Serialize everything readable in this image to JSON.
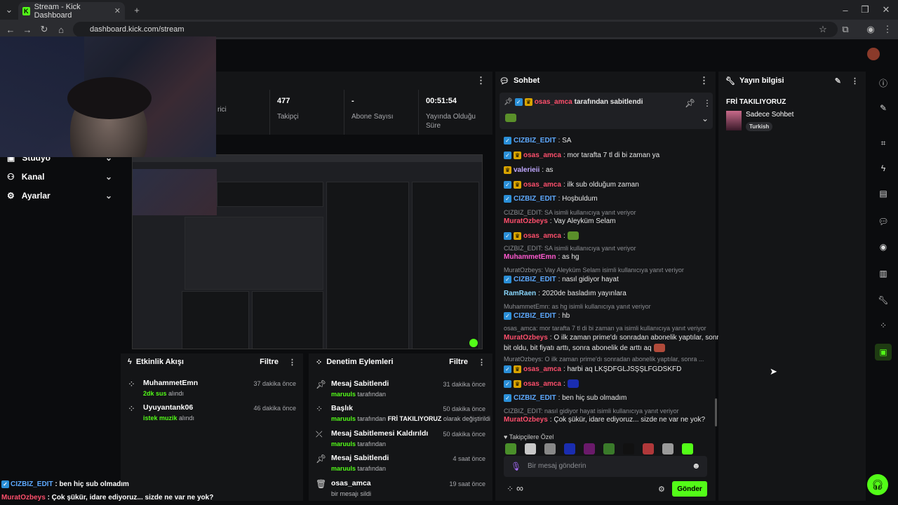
{
  "browser": {
    "tab_title": "Stream - Kick Dashboard",
    "url": "dashboard.kick.com/stream",
    "new_tab": "+",
    "close_tab": "✕"
  },
  "stats": [
    {
      "value": "",
      "label": "rici"
    },
    {
      "value": "477",
      "label": "Takipçi"
    },
    {
      "value": "-",
      "label": "Abone Sayısı"
    },
    {
      "value": "00:51:54",
      "label": "Yayında Olduğu Süre"
    }
  ],
  "nav": [
    {
      "label": "Stüdyo"
    },
    {
      "label": "Kanal"
    },
    {
      "label": "Ayarlar"
    }
  ],
  "chat": {
    "title": "Sohbet",
    "pinned": {
      "user": "osas_amca",
      "text": "tarafından sabitlendi"
    },
    "lines": [
      {
        "type": "msg",
        "user": "CIZBIZ_EDIT",
        "color": "blue",
        "badges": [
          "blue"
        ],
        "text": ": SA"
      },
      {
        "type": "msg",
        "user": "osas_amca",
        "color": "pink",
        "badges": [
          "blue",
          "gold"
        ],
        "text": ": mor tarafta 7 tl di bi zaman ya"
      },
      {
        "type": "msg",
        "user": "valerieii",
        "color": "lav",
        "badges": [
          "gold"
        ],
        "text": ": as"
      },
      {
        "type": "msg",
        "user": "osas_amca",
        "color": "pink",
        "badges": [
          "blue",
          "gold"
        ],
        "text": ": ilk sub olduğum zaman"
      },
      {
        "type": "msg",
        "user": "CIZBIZ_EDIT",
        "color": "blue",
        "badges": [
          "blue"
        ],
        "text": ": Hoşbuldum"
      },
      {
        "type": "reply",
        "text": "CIZBIZ_EDIT: SA isimli kullanıcıya yanıt veriyor"
      },
      {
        "type": "msg",
        "user": "MuratOzbeys",
        "color": "pink",
        "badges": [],
        "text": ": Vay Aleyküm Selam"
      },
      {
        "type": "msg",
        "user": "osas_amca",
        "color": "pink",
        "badges": [
          "blue",
          "gold"
        ],
        "text": ":",
        "emote": "#5a8f2a"
      },
      {
        "type": "reply",
        "text": "CIZBIZ_EDIT: SA isimli kullanıcıya yanıt veriyor"
      },
      {
        "type": "msg",
        "user": "MuhammetEmn",
        "color": "mag",
        "badges": [],
        "text": ": as hg"
      },
      {
        "type": "reply",
        "text": "MuratOzbeys: Vay Aleyküm Selam isimli kullanıcıya yanıt veriyor"
      },
      {
        "type": "msg",
        "user": "CIZBIZ_EDIT",
        "color": "blue",
        "badges": [
          "blue"
        ],
        "text": ": nasıl gidiyor hayat"
      },
      {
        "type": "msg",
        "user": "RamRaen",
        "color": "cyan",
        "badges": [],
        "text": ": 2020de basladım yayınlara"
      },
      {
        "type": "reply",
        "text": "MuhammetEmn: as hg isimli kullanıcıya yanıt veriyor"
      },
      {
        "type": "msg",
        "user": "CIZBIZ_EDIT",
        "color": "blue",
        "badges": [
          "blue"
        ],
        "text": ": hb"
      },
      {
        "type": "reply",
        "text": "osas_amca: mor tarafta 7 tl di bi zaman ya isimli kullanıcıya yanıt veriyor"
      },
      {
        "type": "msg",
        "user": "MuratOzbeys",
        "color": "pink",
        "badges": [],
        "text": ": O ilk zaman prime'dı sonradan abonelik yaptılar, sonra"
      },
      {
        "type": "cont",
        "text": "bit oldu, bit fiyatı arttı, sonra abonelik de arttı aq"
      },
      {
        "type": "reply",
        "text": "MuratOzbeys: O ilk zaman prime'dı sonradan abonelik yaptılar, sonra ..."
      },
      {
        "type": "msg",
        "user": "osas_amca",
        "color": "pink",
        "badges": [
          "blue",
          "gold"
        ],
        "text": ": harbi aq LKŞDFGLJSŞŞLFGDSKFD"
      },
      {
        "type": "msg",
        "user": "osas_amca",
        "color": "pink",
        "badges": [
          "blue",
          "gold"
        ],
        "text": ":",
        "emote": "#1a2db0"
      },
      {
        "type": "msg",
        "user": "CIZBIZ_EDIT",
        "color": "blue",
        "badges": [
          "blue"
        ],
        "text": ": ben hiç sub olmadım"
      },
      {
        "type": "reply",
        "text": "CIZBIZ_EDIT: nasıl gidiyor hayat isimli kullanıcıya yanıt veriyor"
      },
      {
        "type": "msg",
        "user": "MuratOzbeys",
        "color": "pink",
        "badges": [],
        "text": ": Çok şükür, idare ediyoruz... sizde ne var ne yok?"
      }
    ],
    "emote_section": "Takipçilere Özel",
    "emote_colors": [
      "#4a8f2a",
      "#c8c8c8",
      "#888888",
      "#1a2db0",
      "#6a1a6a",
      "#3a7a2a",
      "#111111",
      "#b0383a",
      "#9a9a9a",
      "#53fc18"
    ],
    "input_placeholder": "Bir mesaj gönderin",
    "send_label": "Gönder",
    "infinity": "∞"
  },
  "stream_info": {
    "title_label": "Yayın bilgisi",
    "stream_title": "FRİ TAKILIYORUZ",
    "category": "Sadece Sohbet",
    "tag": "Turkish"
  },
  "events": {
    "title": "Etkinlik Akışı",
    "filter": "Filtre",
    "items": [
      {
        "user": "MuhammetEmn",
        "highlight": "2dk sus",
        "rest": " alındı",
        "time": "37 dakika önce"
      },
      {
        "user": "Uyuyantank06",
        "highlight": "istek muzik",
        "rest": " alındı",
        "time": "46 dakika önce"
      }
    ]
  },
  "moderation": {
    "title": "Denetim Eylemleri",
    "filter": "Filtre",
    "items": [
      {
        "title": "Mesaj Sabitlendi",
        "user": "maruuls",
        "rest": " tarafından",
        "extra": "",
        "extra_rest": "",
        "time": "31 dakika önce",
        "icon": "pin"
      },
      {
        "title": "Başlık",
        "user": "maruuls",
        "rest": " tarafından ",
        "extra": "FRİ TAKILIYORUZ",
        "extra_rest": " olarak değiştirildi",
        "time": "50 dakika önce",
        "icon": "title"
      },
      {
        "title": "Mesaj Sabitlemesi Kaldırıldı",
        "user": "maruuls",
        "rest": " tarafından",
        "extra": "",
        "extra_rest": "",
        "time": "50 dakika önce",
        "icon": "unpin"
      },
      {
        "title": "Mesaj Sabitlendi",
        "user": "maruuls",
        "rest": " tarafından",
        "extra": "",
        "extra_rest": "",
        "time": "4 saat önce",
        "icon": "pin"
      },
      {
        "title": "osas_amca",
        "user": "",
        "rest": "bir mesajı sildi",
        "extra": "",
        "extra_rest": "",
        "time": "19 saat önce",
        "icon": "trash"
      }
    ]
  },
  "overlay": [
    {
      "user": "CIZBIZ_EDIT",
      "text": " : ben hiç sub olmadım"
    },
    {
      "user": "MuratOzbeys",
      "text": " : Çok şükür, idare ediyoruz... sizde ne var ne yok?"
    }
  ],
  "colors": {
    "accent": "#53fc18",
    "bg": "#0b0c0e",
    "panel": "#141517"
  }
}
